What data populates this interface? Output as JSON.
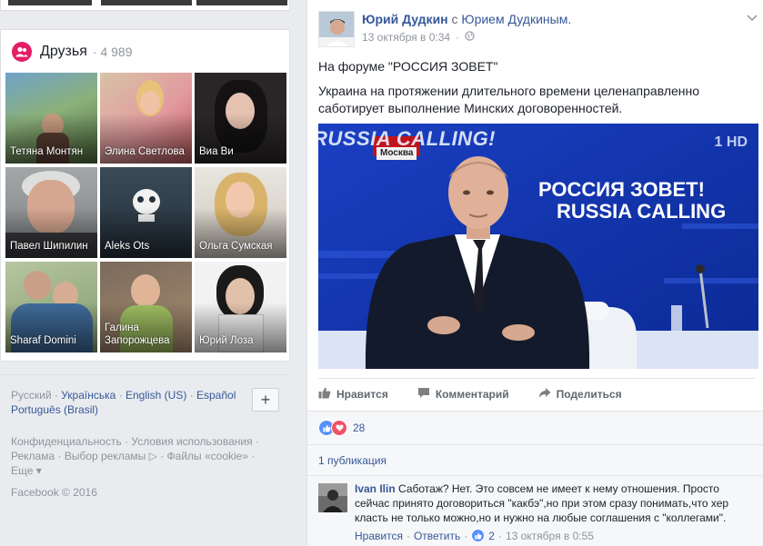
{
  "friends": {
    "title": "Друзья",
    "count": "· 4 989",
    "items": [
      {
        "name": "Тетяна Монтян"
      },
      {
        "name": "Элина Светлова"
      },
      {
        "name": "Виа Ви"
      },
      {
        "name": "Павел Шипилин"
      },
      {
        "name": "Aleks Ots"
      },
      {
        "name": "Ольга Сумская"
      },
      {
        "name": "Sharaf Domini"
      },
      {
        "name": "Галина Запорожцева"
      },
      {
        "name": "Юрий Лоза"
      }
    ]
  },
  "languages": {
    "items": [
      "Русский",
      "Українська",
      "English (US)",
      "Español",
      "Português (Brasil)"
    ],
    "add_label": "+"
  },
  "footer": {
    "privacy": "Конфиденциальность",
    "terms": "Условия использования",
    "advertising": "Реклама",
    "ad_choices": "Выбор рекламы",
    "cookies": "Файлы «cookie»",
    "more": "Еще",
    "copyright": "Facebook © 2016"
  },
  "post": {
    "author": "Юрий Дудкин",
    "with_text": "с",
    "coauthor": "Юрием Дудкиным.",
    "timestamp": "13 октября в 0:34",
    "dot": "·",
    "text_line1": "На форуме \"РОССИЯ ЗОВЕТ\"",
    "text_line2": "Украина на протяжении длительного времени целенаправленно саботирует выполнение Минских договоренностей.",
    "photo": {
      "banner_ru": "РОССИЯ ЗОВЕТ!",
      "banner_en": "RUSSIA CALLING",
      "top_banner": "RUSSIA CALLING!",
      "location": "Москва",
      "channel": "1 HD"
    },
    "actions": {
      "like": "Нравится",
      "comment": "Комментарий",
      "share": "Поделиться"
    },
    "reactions_count": "28",
    "shares": "1 публикация",
    "comment": {
      "author": "Ivan Ilin",
      "text": "Саботаж? Нет. Это совсем не имеет к нему отношения. Просто сейчас принято договориться \"какбэ\",но при этом сразу понимать,что хер класть не только можно,но и нужно на любые соглашения с \"коллегами\".",
      "like": "Нравится",
      "reply": "Ответить",
      "likes": "2",
      "time": "13 октября в 0:55",
      "sep": "·"
    }
  },
  "colors": {
    "brand_blue": "#365899",
    "friends_badge": "#e41e66",
    "photo_bg": "#1233a8"
  }
}
